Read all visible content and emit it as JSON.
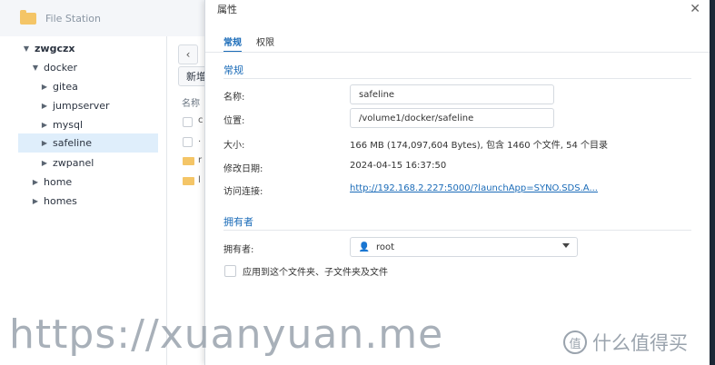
{
  "file_station": {
    "title": "File Station",
    "tree": {
      "root": "zwgczx",
      "docker": "docker",
      "children": [
        "gitea",
        "jumpserver",
        "mysql",
        "safeline",
        "zwpanel"
      ],
      "home": "home",
      "homes": "homes"
    },
    "list": {
      "back_glyph": "‹",
      "new_label": "新增",
      "column_name": "名称",
      "rows": [
        "c",
        ".",
        "r",
        "l"
      ]
    }
  },
  "dialog": {
    "title": "属性",
    "close_glyph": "✕",
    "tabs": [
      "常规",
      "权限"
    ],
    "general": {
      "section_title": "常规",
      "name_label": "名称:",
      "name_value": "safeline",
      "location_label": "位置:",
      "location_value": "/volume1/docker/safeline",
      "size_label": "大小:",
      "size_value": "166 MB (174,097,604 Bytes), 包含 1460 个文件,   54 个目录",
      "modified_label": "修改日期:",
      "modified_value": "2024-04-15 16:37:50",
      "link_label": "访问连接:",
      "link_value": "http://192.168.2.227:5000/?launchApp=SYNO.SDS.A..."
    },
    "owner": {
      "section_title": "拥有者",
      "owner_label": "拥有者:",
      "owner_value": "root",
      "apply_label": "应用到这个文件夹、子文件夹及文件"
    }
  },
  "watermark": {
    "url": "https://xuanyuan.me",
    "badge": "值",
    "brand": "什么值得买"
  }
}
